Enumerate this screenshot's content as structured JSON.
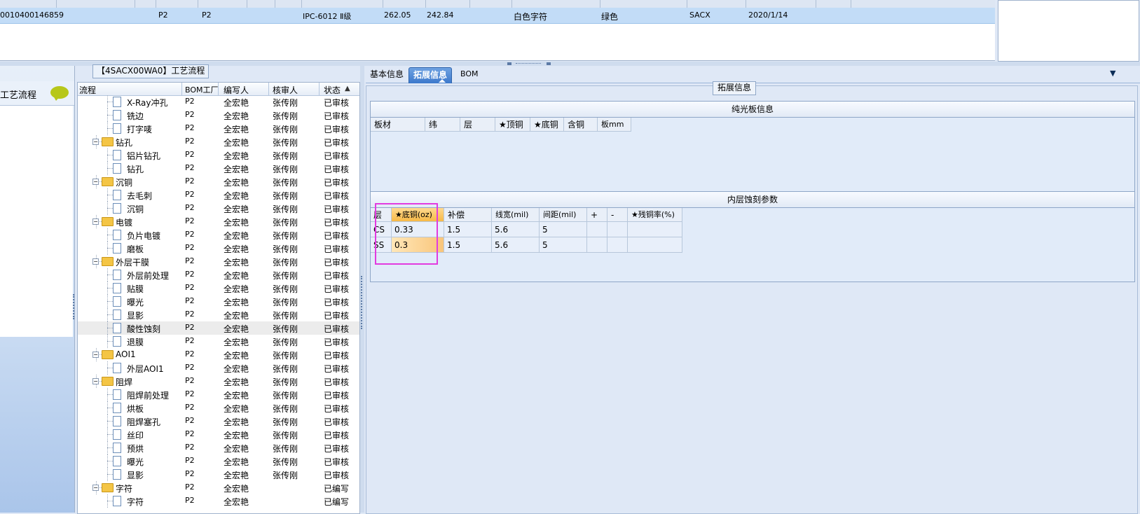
{
  "top_grid": {
    "row": {
      "id": "0010400146859",
      "factory1": "P2",
      "factory2": "P2",
      "grade": "IPC-6012 Ⅱ级",
      "val1": "262.05",
      "val2": "242.84",
      "char_color": "白色字符",
      "mask_color": "绿色",
      "customer": "SACX",
      "date": "2020/1/14"
    }
  },
  "left_panel": {
    "label": "工艺流程"
  },
  "middle": {
    "title": "【4SACX00WA0】工艺流程",
    "columns": [
      "流程",
      "BOM工厂",
      "编写人",
      "核审人",
      "状态"
    ],
    "rows": [
      {
        "name": "X-Ray冲孔",
        "level": 2,
        "type": "doc",
        "factory": "P2",
        "writer": "全宏艳",
        "reviewer": "张传刚",
        "status": "已审核"
      },
      {
        "name": "铣边",
        "level": 2,
        "type": "doc",
        "factory": "P2",
        "writer": "全宏艳",
        "reviewer": "张传刚",
        "status": "已审核"
      },
      {
        "name": "打字唛",
        "level": 2,
        "type": "doc",
        "factory": "P2",
        "writer": "全宏艳",
        "reviewer": "张传刚",
        "status": "已审核"
      },
      {
        "name": "钻孔",
        "level": 1,
        "type": "folder",
        "factory": "P2",
        "writer": "全宏艳",
        "reviewer": "张传刚",
        "status": "已审核"
      },
      {
        "name": "铝片钻孔",
        "level": 2,
        "type": "doc",
        "factory": "P2",
        "writer": "全宏艳",
        "reviewer": "张传刚",
        "status": "已审核"
      },
      {
        "name": "钻孔",
        "level": 2,
        "type": "doc",
        "factory": "P2",
        "writer": "全宏艳",
        "reviewer": "张传刚",
        "status": "已审核"
      },
      {
        "name": "沉铜",
        "level": 1,
        "type": "folder",
        "factory": "P2",
        "writer": "全宏艳",
        "reviewer": "张传刚",
        "status": "已审核"
      },
      {
        "name": "去毛刺",
        "level": 2,
        "type": "doc",
        "factory": "P2",
        "writer": "全宏艳",
        "reviewer": "张传刚",
        "status": "已审核"
      },
      {
        "name": "沉铜",
        "level": 2,
        "type": "doc",
        "factory": "P2",
        "writer": "全宏艳",
        "reviewer": "张传刚",
        "status": "已审核"
      },
      {
        "name": "电镀",
        "level": 1,
        "type": "folder",
        "factory": "P2",
        "writer": "全宏艳",
        "reviewer": "张传刚",
        "status": "已审核"
      },
      {
        "name": "负片电镀",
        "level": 2,
        "type": "doc",
        "factory": "P2",
        "writer": "全宏艳",
        "reviewer": "张传刚",
        "status": "已审核"
      },
      {
        "name": "磨板",
        "level": 2,
        "type": "doc",
        "factory": "P2",
        "writer": "全宏艳",
        "reviewer": "张传刚",
        "status": "已审核"
      },
      {
        "name": "外层干膜",
        "level": 1,
        "type": "folder",
        "factory": "P2",
        "writer": "全宏艳",
        "reviewer": "张传刚",
        "status": "已审核"
      },
      {
        "name": "外层前处理",
        "level": 2,
        "type": "doc",
        "factory": "P2",
        "writer": "全宏艳",
        "reviewer": "张传刚",
        "status": "已审核"
      },
      {
        "name": "贴膜",
        "level": 2,
        "type": "doc",
        "factory": "P2",
        "writer": "全宏艳",
        "reviewer": "张传刚",
        "status": "已审核"
      },
      {
        "name": "曝光",
        "level": 2,
        "type": "doc",
        "factory": "P2",
        "writer": "全宏艳",
        "reviewer": "张传刚",
        "status": "已审核"
      },
      {
        "name": "显影",
        "level": 2,
        "type": "doc",
        "factory": "P2",
        "writer": "全宏艳",
        "reviewer": "张传刚",
        "status": "已审核"
      },
      {
        "name": "酸性蚀刻",
        "level": 2,
        "type": "doc",
        "factory": "P2",
        "writer": "全宏艳",
        "reviewer": "张传刚",
        "status": "已审核",
        "selected": true
      },
      {
        "name": "退膜",
        "level": 2,
        "type": "doc",
        "factory": "P2",
        "writer": "全宏艳",
        "reviewer": "张传刚",
        "status": "已审核"
      },
      {
        "name": "AOI1",
        "level": 1,
        "type": "folder",
        "factory": "P2",
        "writer": "全宏艳",
        "reviewer": "张传刚",
        "status": "已审核"
      },
      {
        "name": "外层AOI1",
        "level": 2,
        "type": "doc",
        "factory": "P2",
        "writer": "全宏艳",
        "reviewer": "张传刚",
        "status": "已审核"
      },
      {
        "name": "阻焊",
        "level": 1,
        "type": "folder",
        "factory": "P2",
        "writer": "全宏艳",
        "reviewer": "张传刚",
        "status": "已审核"
      },
      {
        "name": "阻焊前处理",
        "level": 2,
        "type": "doc",
        "factory": "P2",
        "writer": "全宏艳",
        "reviewer": "张传刚",
        "status": "已审核"
      },
      {
        "name": "烘板",
        "level": 2,
        "type": "doc",
        "factory": "P2",
        "writer": "全宏艳",
        "reviewer": "张传刚",
        "status": "已审核"
      },
      {
        "name": "阻焊塞孔",
        "level": 2,
        "type": "doc",
        "factory": "P2",
        "writer": "全宏艳",
        "reviewer": "张传刚",
        "status": "已审核"
      },
      {
        "name": "丝印",
        "level": 2,
        "type": "doc",
        "factory": "P2",
        "writer": "全宏艳",
        "reviewer": "张传刚",
        "status": "已审核"
      },
      {
        "name": "预烘",
        "level": 2,
        "type": "doc",
        "factory": "P2",
        "writer": "全宏艳",
        "reviewer": "张传刚",
        "status": "已审核"
      },
      {
        "name": "曝光",
        "level": 2,
        "type": "doc",
        "factory": "P2",
        "writer": "全宏艳",
        "reviewer": "张传刚",
        "status": "已审核"
      },
      {
        "name": "显影",
        "level": 2,
        "type": "doc",
        "factory": "P2",
        "writer": "全宏艳",
        "reviewer": "张传刚",
        "status": "已审核"
      },
      {
        "name": "字符",
        "level": 1,
        "type": "folder",
        "factory": "P2",
        "writer": "全宏艳",
        "reviewer": "",
        "status": "已编写"
      },
      {
        "name": "字符",
        "level": 2,
        "type": "doc",
        "factory": "P2",
        "writer": "全宏艳",
        "reviewer": "",
        "status": "已编写"
      }
    ]
  },
  "tabs": [
    "基本信息",
    "拓展信息",
    "BOM"
  ],
  "active_tab": 1,
  "right": {
    "group_label": "拓展信息",
    "plain_board": {
      "title": "纯光板信息",
      "columns": [
        "板材",
        "纬",
        "层",
        "★顶铜",
        "★底铜",
        "含铜",
        "板mm"
      ]
    },
    "inner_etch": {
      "title": "内层蚀刻参数",
      "columns": [
        "层",
        "★底铜(oz)",
        "补偿",
        "线宽(mil)",
        "间距(mil)",
        "+",
        "-",
        "★残铜率(%)"
      ],
      "rows": [
        [
          "CS",
          "0.33",
          "1.5",
          "5.6",
          "5",
          "",
          "",
          ""
        ],
        [
          "SS",
          "0.3",
          "1.5",
          "5.6",
          "5",
          "",
          "",
          ""
        ]
      ]
    }
  },
  "colors": {
    "selected_row": "#c2dcf7",
    "active_tab": "#3b78cc",
    "highlight_cell": "#f7b947",
    "annotation_box": "#e23be0"
  }
}
